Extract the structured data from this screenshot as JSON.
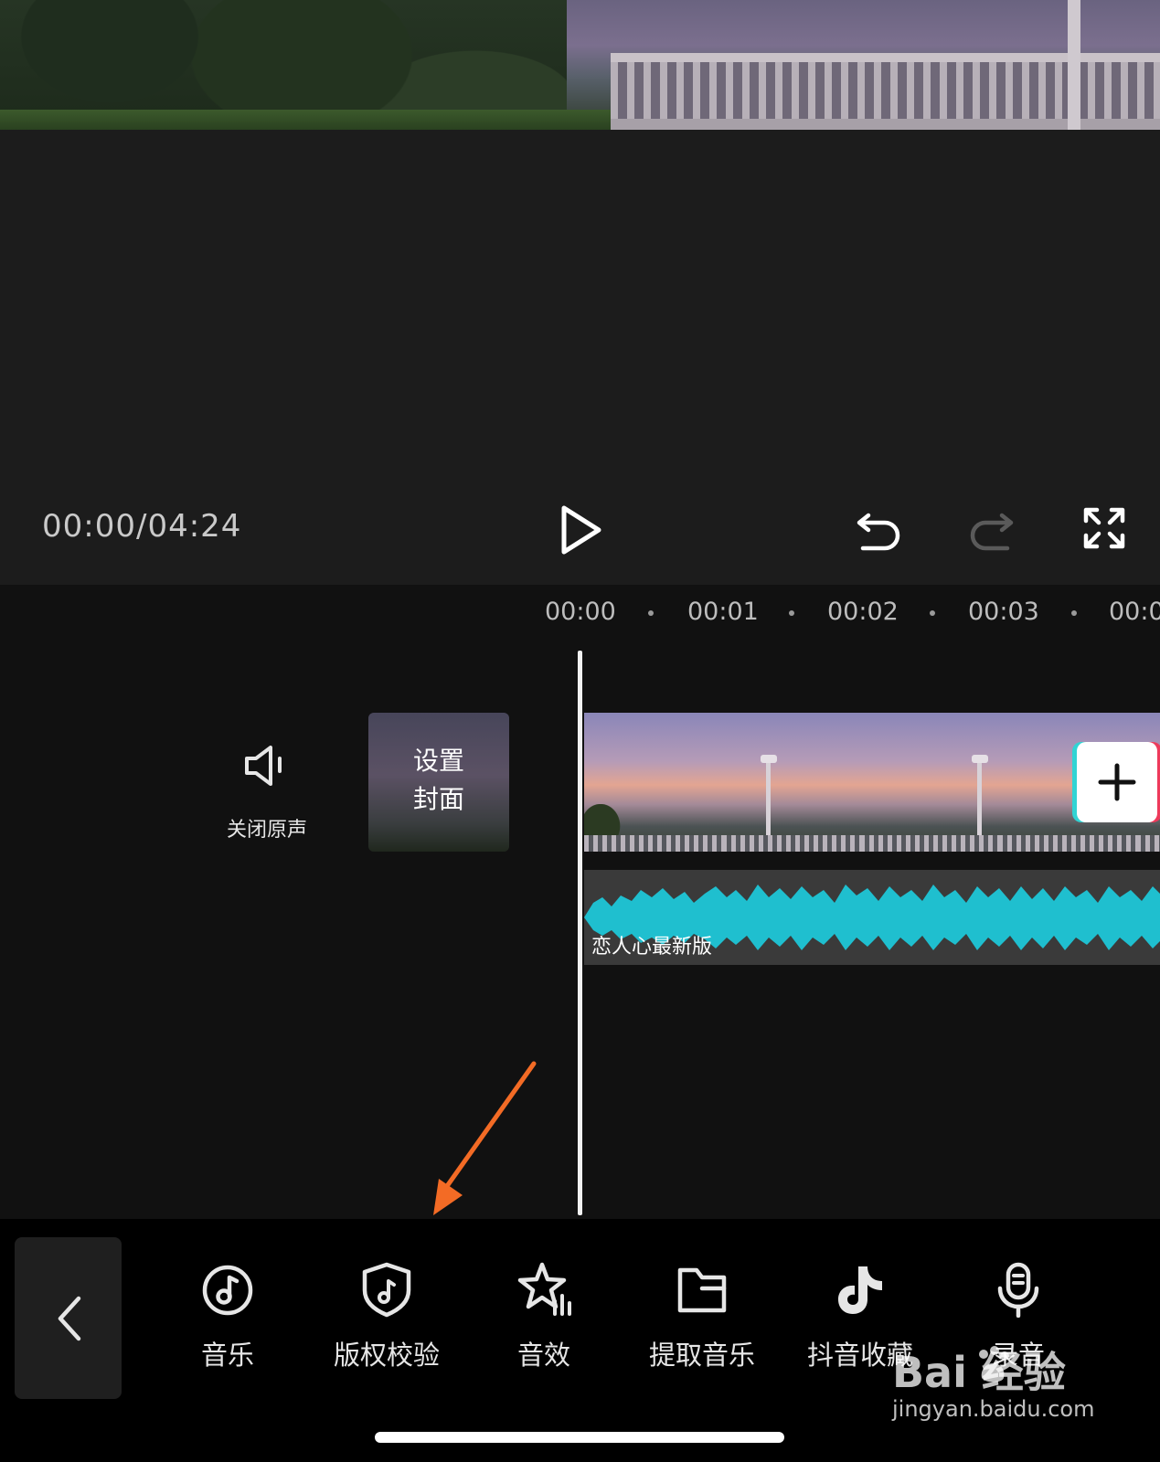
{
  "player": {
    "time": "00:00/04:24"
  },
  "timeline": {
    "ruler": [
      "00:00",
      "00:01",
      "00:02",
      "00:03",
      "00:0"
    ],
    "mute_label": "关闭原声",
    "cover_line1": "设置",
    "cover_line2": "封面",
    "audio_clip_label": "恋人心最新版"
  },
  "toolbar": {
    "items": [
      {
        "label": "音乐",
        "icon": "music-note-icon"
      },
      {
        "label": "版权校验",
        "icon": "copyright-shield-icon"
      },
      {
        "label": "音效",
        "icon": "sound-effect-star-icon"
      },
      {
        "label": "提取音乐",
        "icon": "folder-icon"
      },
      {
        "label": "抖音收藏",
        "icon": "tiktok-icon"
      },
      {
        "label": "录音",
        "icon": "microphone-icon"
      }
    ]
  },
  "watermark": {
    "brand": "Bai  经验",
    "url": "jingyan.baidu.com"
  },
  "colors": {
    "waveform": "#1fbfcf",
    "annotation_arrow": "#f36b25",
    "accent_cyan": "#31d4d4",
    "accent_red": "#ee3a5b"
  }
}
